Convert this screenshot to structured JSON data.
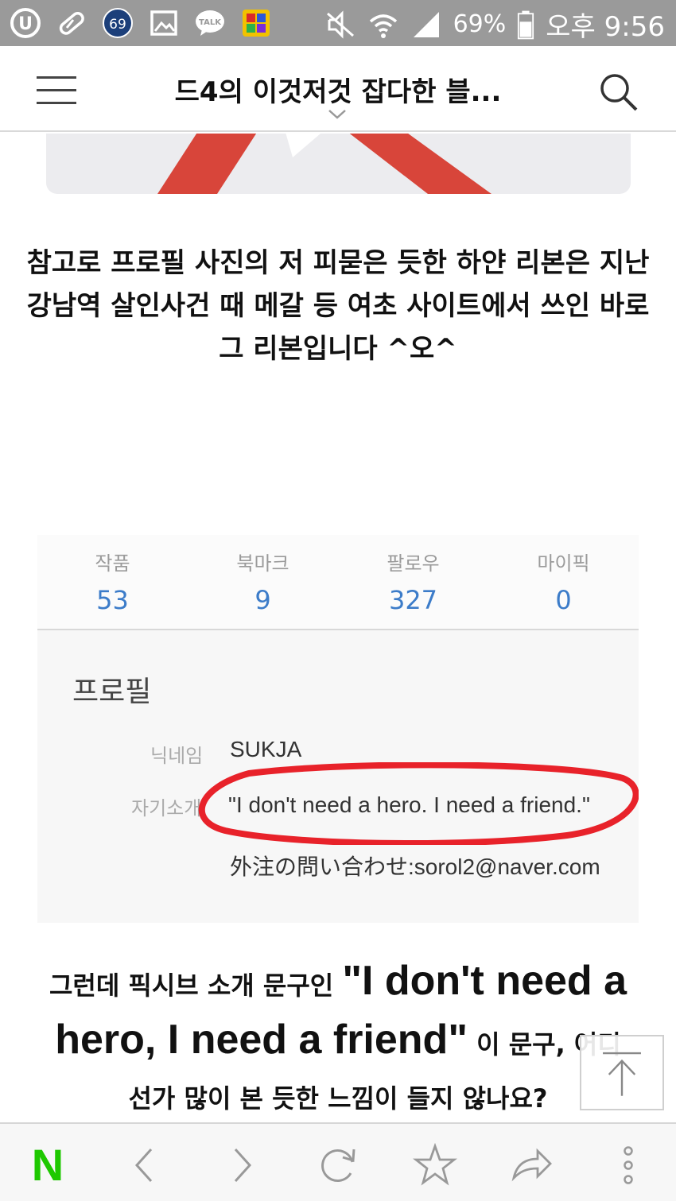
{
  "status_bar": {
    "notification_badge": "69",
    "talk_label": "TALK",
    "battery": "69%",
    "time": "오후 9:56"
  },
  "header": {
    "title": "드4의 이것저것 잡다한 블..."
  },
  "content": {
    "paragraph1": "참고로 프로필 사진의 저 피묻은 듯한 하얀 리본은 지난 강남역 살인사건 때 메갈 등 여초 사이트에서 쓰인 바로 그 리본입니다 ^오^",
    "screenshot": {
      "stats": [
        {
          "label": "작품",
          "value": "53"
        },
        {
          "label": "북마크",
          "value": "9"
        },
        {
          "label": "팔로우",
          "value": "327"
        },
        {
          "label": "마이픽",
          "value": "0"
        }
      ],
      "profile_heading": "프로필",
      "nickname_label": "닉네임",
      "nickname_value": "SUKJA",
      "intro_label": "자기소개",
      "intro_value": "\"I don't need a hero. I need a friend.\"",
      "contact_value": "外注の問い合わせ:sorol2@naver.com"
    },
    "paragraph2": {
      "part1": "그런데 픽시브 소개 문구인 ",
      "quote": "\"I don't need a hero, I need a friend\"",
      "part2": " 이 문구, 어디",
      "line3": "선가 많이 본 듯한 느낌이 들지 않나요?"
    }
  },
  "toolbar": {
    "logo_text": "N"
  },
  "colors": {
    "status_bar": "#9a9a9a",
    "stat_value": "#3c7cc9",
    "highlight_circle": "#e8222a",
    "naver_green": "#1ec800"
  }
}
